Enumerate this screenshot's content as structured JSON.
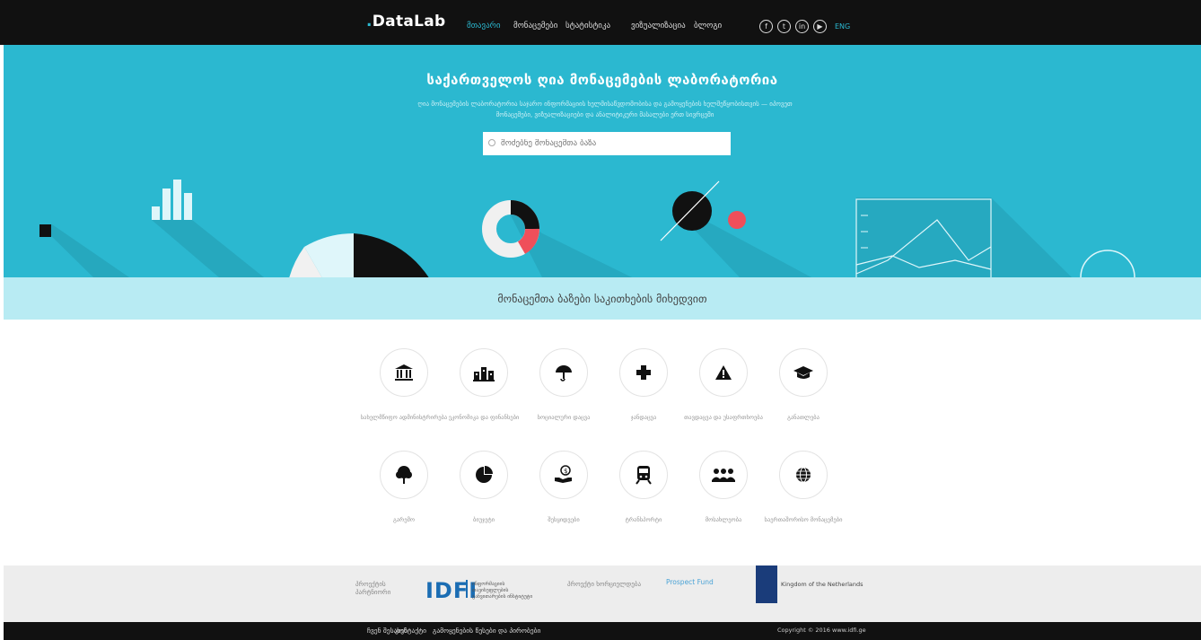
{
  "header": {
    "logo_dot": ".",
    "logo_text": "DataLab",
    "nav": [
      "მთავარი",
      "მონაცემები",
      "სტატისტიკა",
      "ვიზუალიზაცია",
      "ბლოგი"
    ],
    "active_index": 0,
    "social": [
      "facebook-icon",
      "twitter-icon",
      "linkedin-icon",
      "youtube-icon"
    ],
    "lang": "ENG"
  },
  "hero": {
    "title": "საქართველოს ღია მონაცემების ლაბორატორია",
    "subtitle": "ღია მონაცემების ლაბორატორია საჯარო ინფორმაციის ხელმისაწვდომობისა და გამოყენების ხელშეწყობისთვის — იპოვეთ მონაცემები, ვიზუალიზაციები და ანალიტიკური მასალები ერთ სივრცეში",
    "search_placeholder": "მოძებნე მონაცემთა ბაზა"
  },
  "band": {
    "title": "მონაცემთა ბაზები საკითხების მიხედვით"
  },
  "categories": [
    {
      "icon": "government-icon",
      "label": "სახელმწიფო ადმინისტრირება"
    },
    {
      "icon": "economy-icon",
      "label": "ეკონომიკა და ფინანსები"
    },
    {
      "icon": "social-protection-icon",
      "label": "სოციალური დაცვა"
    },
    {
      "icon": "health-icon",
      "label": "ჯანდაცვა"
    },
    {
      "icon": "security-icon",
      "label": "თავდაცვა და უსაფრთხოება"
    },
    {
      "icon": "education-icon",
      "label": "განათლება"
    },
    {
      "icon": "environment-icon",
      "label": "გარემო"
    },
    {
      "icon": "budget-icon",
      "label": "ბიუჯეტი"
    },
    {
      "icon": "procurement-icon",
      "label": "შესყიდვები"
    },
    {
      "icon": "transport-icon",
      "label": "ტრანსპორტი"
    },
    {
      "icon": "population-icon",
      "label": "მოსახლეობა"
    },
    {
      "icon": "international-icon",
      "label": "საერთაშორისო მონაცემები"
    }
  ],
  "partners": {
    "org_label": "პროექტის პარტნიორი",
    "idfi": "IDFI",
    "idfi_sub": "ინფორმაციის თავისუფლების განვითარების ინსტიტუტი",
    "support_label": "პროექტი ხორციელდება",
    "prospect": "Prospect Fund",
    "nl": "Kingdom of the Netherlands"
  },
  "footer": {
    "links": [
      "ჩვენ შესახებ",
      "კონტაქტი",
      "გამოყენების წესები და პირობები"
    ],
    "copyright": "Copyright © 2016 www.idfi.ge"
  }
}
